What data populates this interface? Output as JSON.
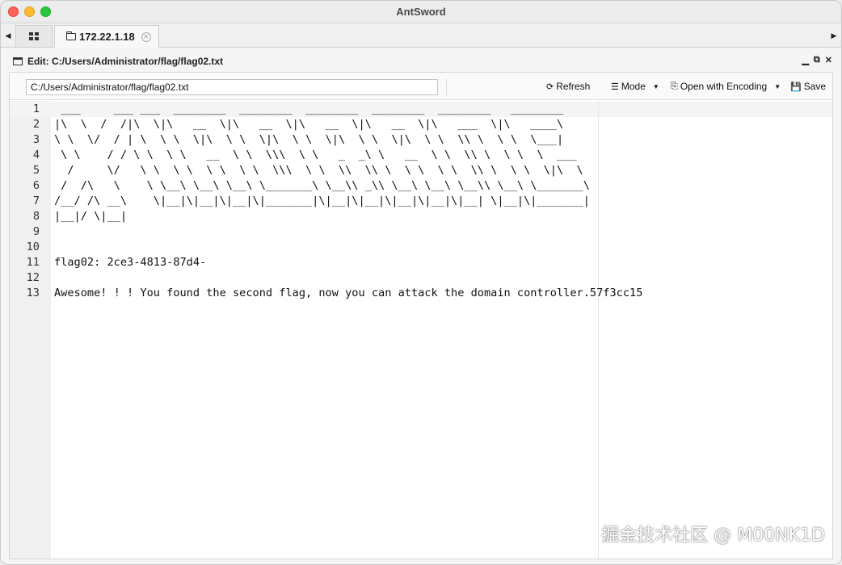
{
  "app": {
    "title": "AntSword"
  },
  "tabs": {
    "home_icon": "grid-icon",
    "active_label": "172.22.1.18",
    "active_icon": "folder-icon"
  },
  "panel": {
    "title": "Edit: C:/Users/Administrator/flag/flag02.txt",
    "controls": {
      "minimize": "▁",
      "restore": "⧉",
      "close": "✕"
    }
  },
  "toolbar": {
    "path_value": "C:/Users/Administrator/flag/flag02.txt",
    "refresh_label": "Refresh",
    "mode_label": "Mode",
    "encoding_label": "Open with Encoding",
    "save_label": "Save"
  },
  "editor": {
    "lines": [
      " ___     ___ ___  ________  ________  ________  ________  ________   ________",
      "|\\  \\  /  /|\\  \\|\\   __  \\|\\   __  \\|\\   __  \\|\\   __  \\|\\   ___  \\|\\   ____\\",
      "\\ \\  \\/  / | \\  \\ \\  \\|\\  \\ \\  \\|\\  \\ \\  \\|\\  \\ \\  \\|\\  \\ \\  \\\\ \\  \\ \\  \\___|",
      " \\ \\    / / \\ \\  \\ \\   __  \\ \\  \\\\\\  \\ \\   _  _\\ \\   __  \\ \\  \\\\ \\  \\ \\  \\  ___",
      "  /     \\/   \\ \\  \\ \\  \\ \\  \\ \\  \\\\\\  \\ \\  \\\\  \\\\ \\  \\ \\  \\ \\  \\\\ \\  \\ \\  \\|\\  \\",
      " /  /\\   \\    \\ \\__\\ \\__\\ \\__\\ \\_______\\ \\__\\\\ _\\\\ \\__\\ \\__\\ \\__\\\\ \\__\\ \\_______\\",
      "/__/ /\\ __\\    \\|__|\\|__|\\|__|\\|_______|\\|__|\\|__|\\|__|\\|__|\\|__| \\|__|\\|_______|",
      "|__|/ \\|__|",
      "",
      "",
      "flag02: 2ce3-4813-87d4-",
      "",
      "Awesome! ! ! You found the second flag, now you can attack the domain controller.57f3cc15"
    ]
  },
  "watermark": "掘金技术社区 @ M00NK1D"
}
